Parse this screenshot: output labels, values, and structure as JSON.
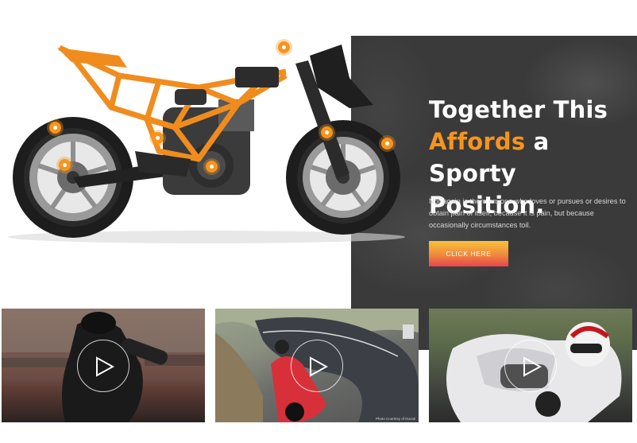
{
  "hero": {
    "headline_part1": "Together This",
    "headline_accent": "Affords",
    "headline_part2": "a Sporty",
    "headline_part3": "Position.",
    "paragraph": "Nor again is there anyone who loves or pursues or desires to obtain pain of itself, because it is pain, but because occasionally circumstances toil.",
    "cta_label": "CLICK HERE"
  },
  "colors": {
    "accent": "#f7941d",
    "panel": "#3a3a3a",
    "cta_top": "#f8c23a",
    "cta_bottom": "#e8454f"
  },
  "icons": {
    "hotspot": "hotspot-dot-icon",
    "play": "play-icon"
  },
  "videos": [
    {
      "label": "Rider on black sport bike at dusk"
    },
    {
      "label": "Red sport bike on mountain road",
      "credit": "Photo Courtesy of Ducati"
    },
    {
      "label": "Rider on white sport bike on track"
    }
  ]
}
